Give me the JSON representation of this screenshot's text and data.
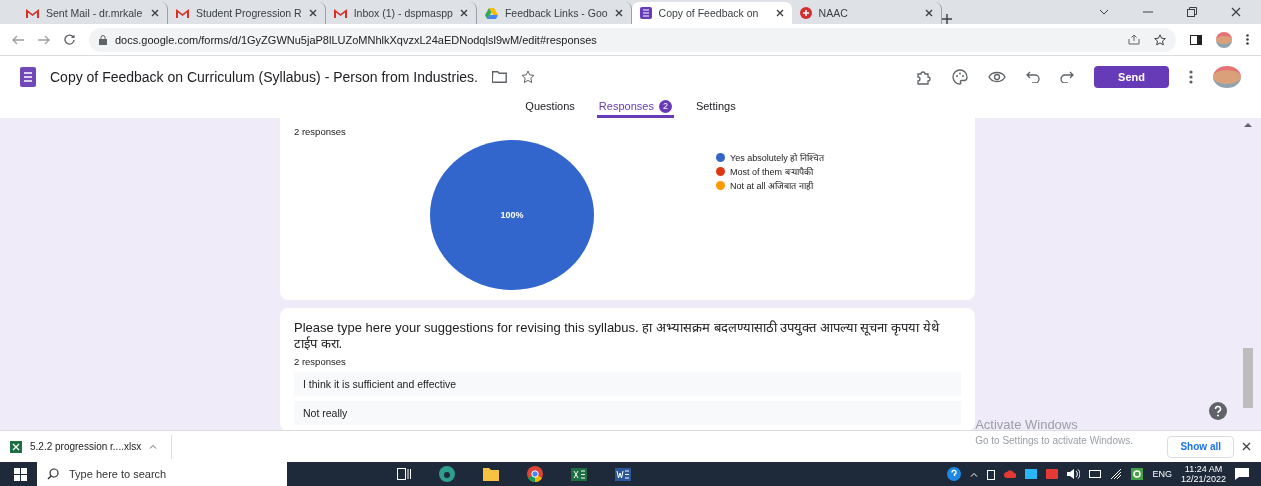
{
  "browser_tabs": [
    {
      "title": "Sent Mail - dr.mrkale",
      "kind": "gmail",
      "selected": false
    },
    {
      "title": "Student Progression R",
      "kind": "gmail",
      "selected": false
    },
    {
      "title": "Inbox (1) - dspmaspp",
      "kind": "gmail",
      "selected": false
    },
    {
      "title": "Feedback Links - Goo",
      "kind": "drive",
      "selected": false
    },
    {
      "title": "Copy of Feedback on",
      "kind": "forms",
      "selected": true
    },
    {
      "title": "NAAC",
      "kind": "naac",
      "selected": false
    }
  ],
  "address_bar": {
    "url": "docs.google.com/forms/d/1GyZGWNu5jaP8lLUZoMNhlkXqvzxL24aEDNodqlsl9wM/edit#responses"
  },
  "form_header": {
    "title": "Copy of Feedback on Curriculum (Syllabus) - Person from Industries.",
    "send_label": "Send"
  },
  "form_tabs": [
    {
      "label": "Questions",
      "selected": false
    },
    {
      "label": "Responses",
      "badge": "2",
      "selected": true
    },
    {
      "label": "Settings",
      "selected": false
    }
  ],
  "cards": [
    {
      "kind": "chart",
      "responses": "2 responses",
      "chart_data": {
        "type": "pie",
        "values": [
          100,
          0,
          0
        ],
        "data_labels": true,
        "value_labels": [
          "100%",
          null,
          null
        ]
      },
      "legend": [
        {
          "label": "Yes absolutely हो निश्चित",
          "color": "#3366cc"
        },
        {
          "label": "Most of them बऱ्यापैकी",
          "color": "#dc3912"
        },
        {
          "label": "Not at all अजिबात नाही",
          "color": "#ff9900"
        }
      ]
    },
    {
      "kind": "text",
      "question": "Please type here your suggestions for revising this syllabus. हा अभ्यासक्रम बदलण्यासाठी उपयुक्त आपल्या सूचना कृपया येथे टाईप करा.",
      "responses": "2 responses",
      "answers": [
        "I think it is sufficient and effective",
        "Not really"
      ]
    }
  ],
  "activation": {
    "title": "Activate Windows",
    "hint": "Go to Settings to activate Windows."
  },
  "downloads": {
    "file": "5.2.2 progression r....xlsx",
    "show_all": "Show all"
  },
  "taskbar": {
    "search_placeholder": "Type here to search",
    "language": "ENG",
    "time": "11:24 AM",
    "date": "12/21/2022"
  }
}
